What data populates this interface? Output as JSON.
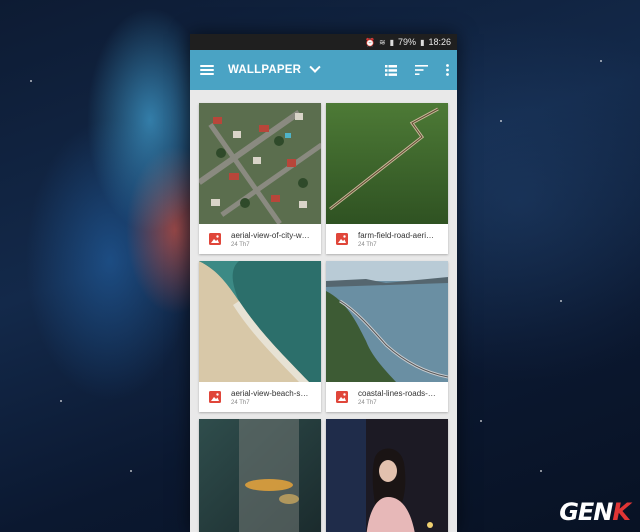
{
  "status_bar": {
    "battery": "79%",
    "time": "18:26"
  },
  "app_bar": {
    "title": "WALLPAPER",
    "icons": [
      "menu-icon",
      "chevron-down-icon",
      "list-view-icon",
      "sort-icon",
      "more-vert-icon"
    ]
  },
  "files": [
    {
      "name": "aerial-view-of-city-w…",
      "date": "24 Th7",
      "icon": "image-icon"
    },
    {
      "name": "farm-field-road-aeri…",
      "date": "24 Th7",
      "icon": "image-icon"
    },
    {
      "name": "aerial-view-beach-s…",
      "date": "24 Th7",
      "icon": "image-icon"
    },
    {
      "name": "coastal-lines-roads-…",
      "date": "24 Th7",
      "icon": "image-icon"
    },
    {
      "name": "",
      "date": "",
      "icon": "image-icon"
    },
    {
      "name": "",
      "date": "",
      "icon": "image-icon"
    }
  ],
  "watermark": {
    "text": "GENK"
  },
  "colors": {
    "app_bar": "#4aa3c4",
    "status_bar": "#1f1f1f",
    "image_icon": "#e0463a",
    "background": "#13294a"
  }
}
